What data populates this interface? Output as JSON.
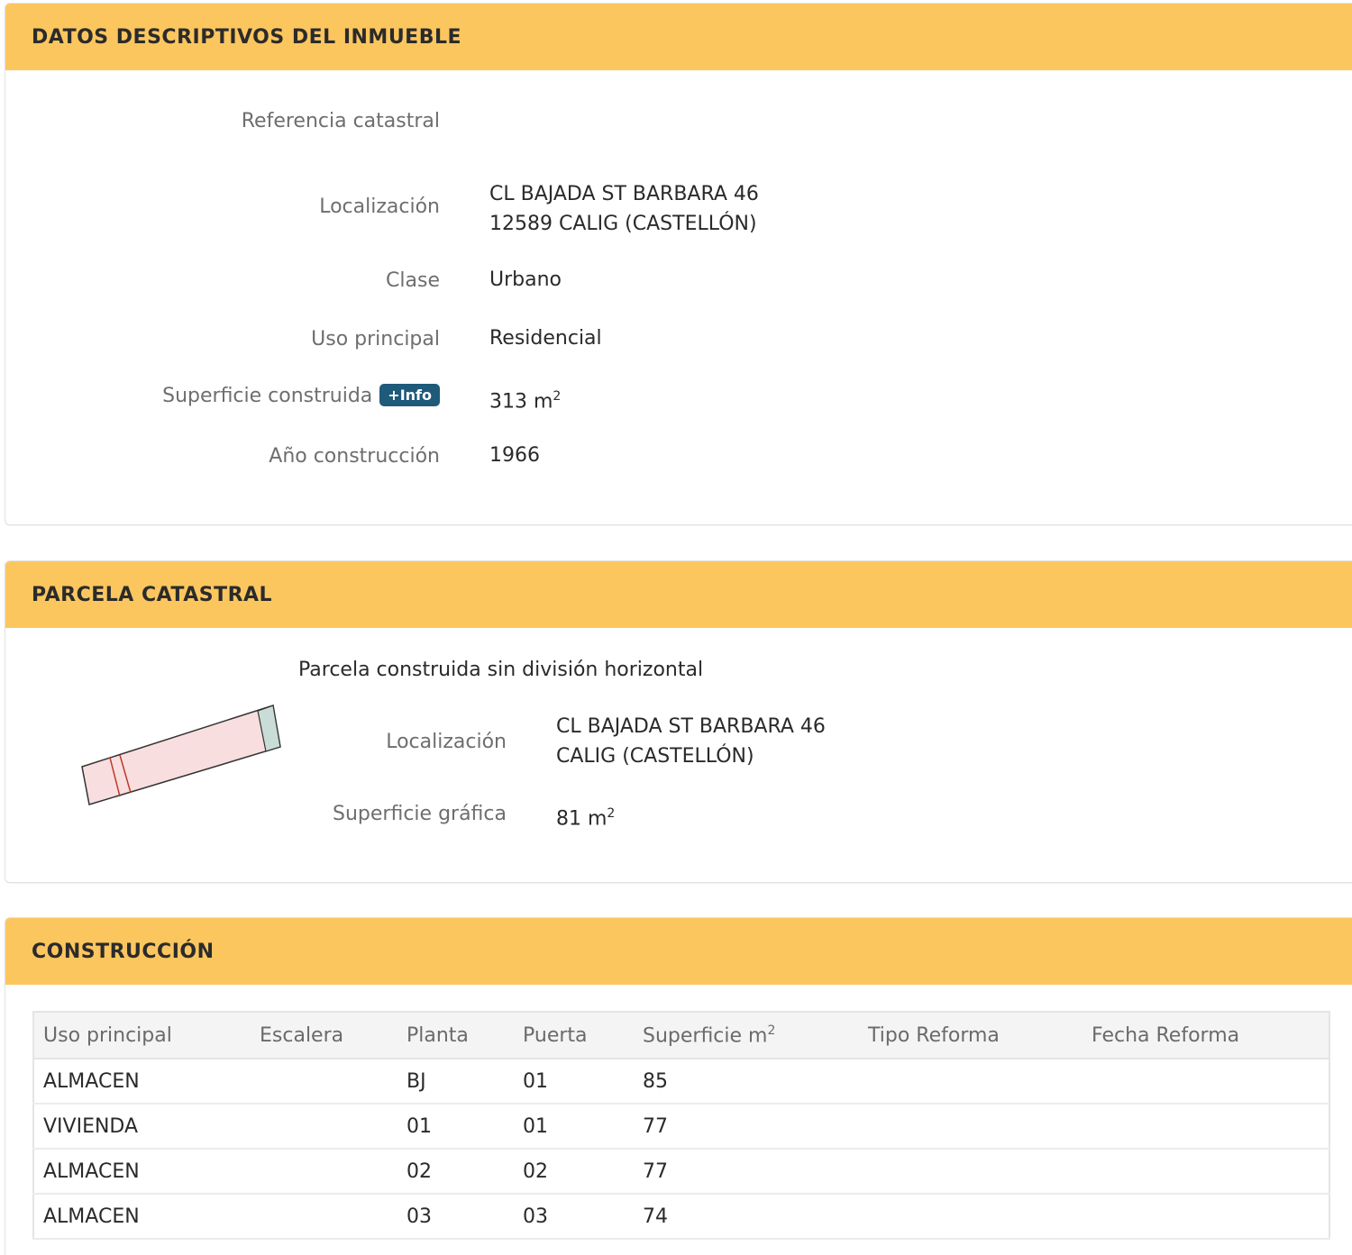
{
  "datos": {
    "header": "DATOS DESCRIPTIVOS DEL INMUEBLE",
    "referencia_label": "Referencia catastral",
    "localizacion_label": "Localización",
    "localizacion_line1": "CL BAJADA ST BARBARA 46",
    "localizacion_line2": "12589 CALIG (CASTELLÓN)",
    "clase_label": "Clase",
    "clase_value": "Urbano",
    "uso_label": "Uso principal",
    "uso_value": "Residencial",
    "superficie_label": "Superficie construida",
    "info_badge": "+Info",
    "superficie_value": "313 m",
    "superficie_unit_exp": "2",
    "anio_label": "Año construcción",
    "anio_value": "1966"
  },
  "parcela": {
    "header": "PARCELA CATASTRAL",
    "subtitle": "Parcela construida sin división horizontal",
    "localizacion_label": "Localización",
    "localizacion_line1": "CL BAJADA ST BARBARA 46",
    "localizacion_line2": "CALIG (CASTELLÓN)",
    "superficie_label": "Superficie gráfica",
    "superficie_value": "81 m",
    "superficie_unit_exp": "2"
  },
  "construccion": {
    "header": "CONSTRUCCIÓN",
    "columns": [
      "Uso principal",
      "Escalera",
      "Planta",
      "Puerta",
      "Superficie m",
      "Tipo Reforma",
      "Fecha Reforma"
    ],
    "superficie_col_exp": "2",
    "rows": [
      [
        "ALMACEN",
        "",
        "BJ",
        "01",
        "85",
        "",
        ""
      ],
      [
        "VIVIENDA",
        "",
        "01",
        "01",
        "77",
        "",
        ""
      ],
      [
        "ALMACEN",
        "",
        "02",
        "02",
        "77",
        "",
        ""
      ],
      [
        "ALMACEN",
        "",
        "03",
        "03",
        "74",
        "",
        ""
      ]
    ]
  },
  "colors": {
    "header_bg": "#fcc65e",
    "badge_bg": "#1f5a7a",
    "parcel_fill": "#f8dede",
    "parcel_stroke": "#333333",
    "parcel_end_fill": "#c9dcd8",
    "parcel_divider": "#c0392b"
  }
}
